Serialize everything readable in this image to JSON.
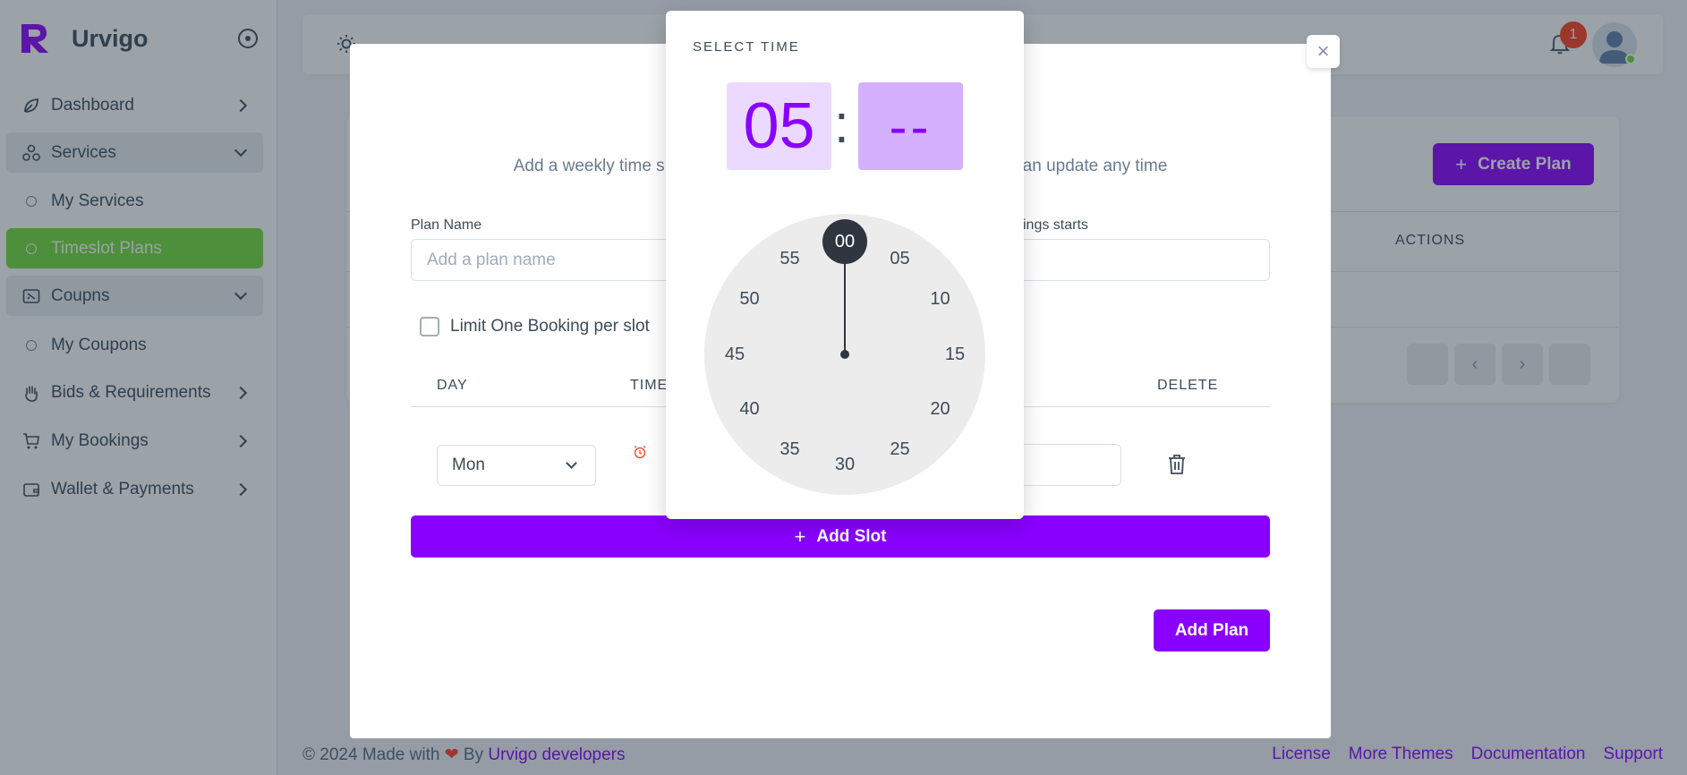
{
  "brand": {
    "name": "Urvigo"
  },
  "sidebar": {
    "items": [
      {
        "label": "Dashboard",
        "icon": "leaf-icon"
      },
      {
        "label": "Services",
        "icon": "shapes-icon"
      },
      {
        "label": "My Services"
      },
      {
        "label": "Timeslot Plans"
      },
      {
        "label": "Coupns",
        "icon": "ticket-icon"
      },
      {
        "label": "My Coupons"
      },
      {
        "label": "Bids & Requirements",
        "icon": "hand-icon"
      },
      {
        "label": "My Bookings",
        "icon": "cart-icon"
      },
      {
        "label": "Wallet & Payments",
        "icon": "wallet-icon"
      }
    ]
  },
  "navbar": {
    "notification_count": "1"
  },
  "background_page": {
    "create_button": "Create Plan",
    "actions_header": "ACTIONS",
    "pager": {
      "prev": "‹",
      "next": "›"
    }
  },
  "modal": {
    "subtitle_left": "Add a weekly time s",
    "subtitle_right": "an update any time",
    "plan_name_label": "Plan Name",
    "plan_name_placeholder": "Add a plan name",
    "bookings_label": "ings starts",
    "limit_label": "Limit One Booking per slot",
    "table_headers": {
      "day": "DAY",
      "time": "TIME",
      "delete": "DELETE"
    },
    "row": {
      "day": "Mon"
    },
    "add_slot": "Add Slot",
    "add_plan": "Add Plan",
    "close": "×"
  },
  "time_picker": {
    "title": "SELECT TIME",
    "hour": "05",
    "separator": ":",
    "minute": "--",
    "selected_minute": "00",
    "minutes": [
      "00",
      "05",
      "10",
      "15",
      "20",
      "25",
      "30",
      "35",
      "40",
      "45",
      "50",
      "55"
    ]
  },
  "footer": {
    "copyright": "© 2024 Made with",
    "by": "By",
    "author": "Urvigo developers",
    "links": [
      "License",
      "More Themes",
      "Documentation",
      "Support"
    ]
  },
  "colors": {
    "accent": "#8a00ff",
    "active": "#71dd37",
    "danger": "#ff3e1d"
  }
}
